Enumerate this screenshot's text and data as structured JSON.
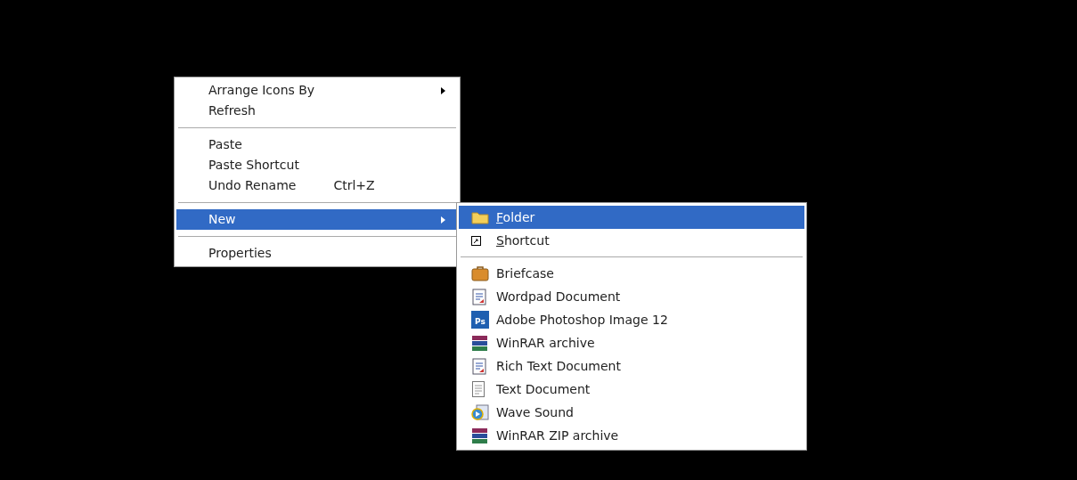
{
  "context_menu": {
    "items": [
      {
        "kind": "item",
        "label": "Arrange Icons By",
        "submenu": true,
        "selected": false
      },
      {
        "kind": "item",
        "label": "Refresh",
        "submenu": false,
        "selected": false
      },
      {
        "kind": "separator"
      },
      {
        "kind": "item",
        "label": "Paste",
        "submenu": false,
        "selected": false
      },
      {
        "kind": "item",
        "label": "Paste Shortcut",
        "submenu": false,
        "selected": false
      },
      {
        "kind": "item",
        "label": "Undo Rename",
        "shortcut": "Ctrl+Z",
        "submenu": false,
        "selected": false
      },
      {
        "kind": "separator"
      },
      {
        "kind": "item",
        "label": "New",
        "submenu": true,
        "selected": true
      },
      {
        "kind": "separator"
      },
      {
        "kind": "item",
        "label": "Properties",
        "submenu": false,
        "selected": false
      }
    ]
  },
  "new_submenu": {
    "items": [
      {
        "kind": "folder",
        "label": "Folder",
        "mnemonic": true,
        "selected": true
      },
      {
        "kind": "shortcut",
        "label": "Shortcut",
        "mnemonic": true,
        "selected": false
      },
      {
        "kind": "separator"
      },
      {
        "kind": "briefcase",
        "label": "Briefcase",
        "mnemonic": false,
        "selected": false
      },
      {
        "kind": "wordpad",
        "label": "Wordpad Document",
        "mnemonic": false,
        "selected": false
      },
      {
        "kind": "photoshop",
        "icon_text": "Ps",
        "label": "Adobe Photoshop Image 12",
        "mnemonic": false,
        "selected": false
      },
      {
        "kind": "archive",
        "label": "WinRAR archive",
        "mnemonic": false,
        "selected": false
      },
      {
        "kind": "wordpad",
        "label": "Rich Text Document",
        "mnemonic": false,
        "selected": false
      },
      {
        "kind": "text",
        "label": "Text Document",
        "mnemonic": false,
        "selected": false
      },
      {
        "kind": "sound",
        "label": "Wave Sound",
        "mnemonic": false,
        "selected": false
      },
      {
        "kind": "archive",
        "label": "WinRAR ZIP archive",
        "mnemonic": false,
        "selected": false
      }
    ]
  }
}
